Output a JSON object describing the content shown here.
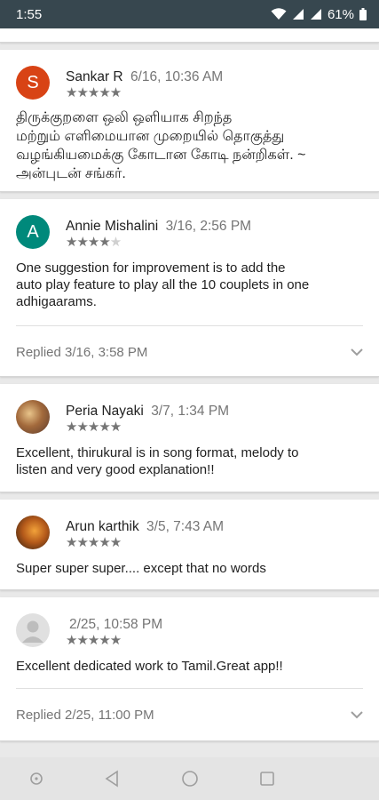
{
  "status_bar": {
    "time": "1:55",
    "battery": "61%"
  },
  "reviews": [
    {
      "author": "Sankar R",
      "time": "6/16, 10:36 AM",
      "rating": 5,
      "avatar_letter": "S",
      "avatar_color": "#d84315",
      "text_lines": [
        "திருக்குறளை ஒலி ஒளியாக சிறந்த",
        "மற்றும் எளிமையான முறையில் தொகுத்து",
        "வழங்கியமைக்கு கோடான கோடி நன்றிகள். ~",
        "அன்புடன் சங்கர்."
      ]
    },
    {
      "author": "Annie Mishalini",
      "time": "3/16, 2:56 PM",
      "rating": 4,
      "avatar_letter": "A",
      "avatar_color": "#00897b",
      "text_lines": [
        "One suggestion for improvement is to add the",
        "auto play feature to play all the 10 couplets in one",
        "adhigaarams."
      ],
      "reply": "Replied 3/16, 3:58 PM"
    },
    {
      "author": "Peria Nayaki",
      "time": "3/7, 1:34 PM",
      "rating": 5,
      "text_lines": [
        "Excellent, thirukural is in song format, melody to",
        "listen and very good explanation!!"
      ]
    },
    {
      "author": "Arun karthik",
      "time": "3/5, 7:43 AM",
      "rating": 5,
      "text_lines": [
        "Super super super.... except that no words"
      ]
    },
    {
      "author": "",
      "time": "2/25, 10:58 PM",
      "rating": 5,
      "text_lines": [
        "Excellent dedicated work to Tamil.Great app!!"
      ],
      "reply": "Replied 2/25, 11:00 PM"
    }
  ],
  "icons": {
    "star": "★",
    "expand": "chevron-down-icon"
  },
  "colors": {
    "status_bar": "#37474f",
    "text_secondary": "#757575"
  }
}
